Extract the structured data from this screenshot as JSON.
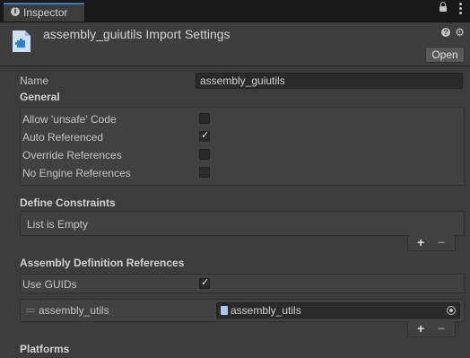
{
  "tab": {
    "label": "Inspector"
  },
  "header": {
    "title": "assembly_guiutils Import Settings",
    "open_label": "Open"
  },
  "name_field": {
    "label": "Name",
    "value": "assembly_guiutils"
  },
  "general": {
    "title": "General",
    "options": [
      {
        "label": "Allow 'unsafe' Code",
        "checked": false
      },
      {
        "label": "Auto Referenced",
        "checked": true
      },
      {
        "label": "Override References",
        "checked": false
      },
      {
        "label": "No Engine References",
        "checked": false
      }
    ]
  },
  "define_constraints": {
    "title": "Define Constraints",
    "empty_text": "List is Empty"
  },
  "assembly_refs": {
    "title": "Assembly Definition References",
    "use_guids_label": "Use GUIDs",
    "use_guids_checked": true,
    "items": [
      {
        "label": "assembly_utils",
        "value": "assembly_utils"
      }
    ]
  },
  "platforms": {
    "title": "Platforms"
  },
  "list_controls": {
    "add": "+",
    "remove": "−"
  },
  "icons": {
    "check": "✓",
    "info": "i",
    "help": "?",
    "gear": "⚙"
  }
}
